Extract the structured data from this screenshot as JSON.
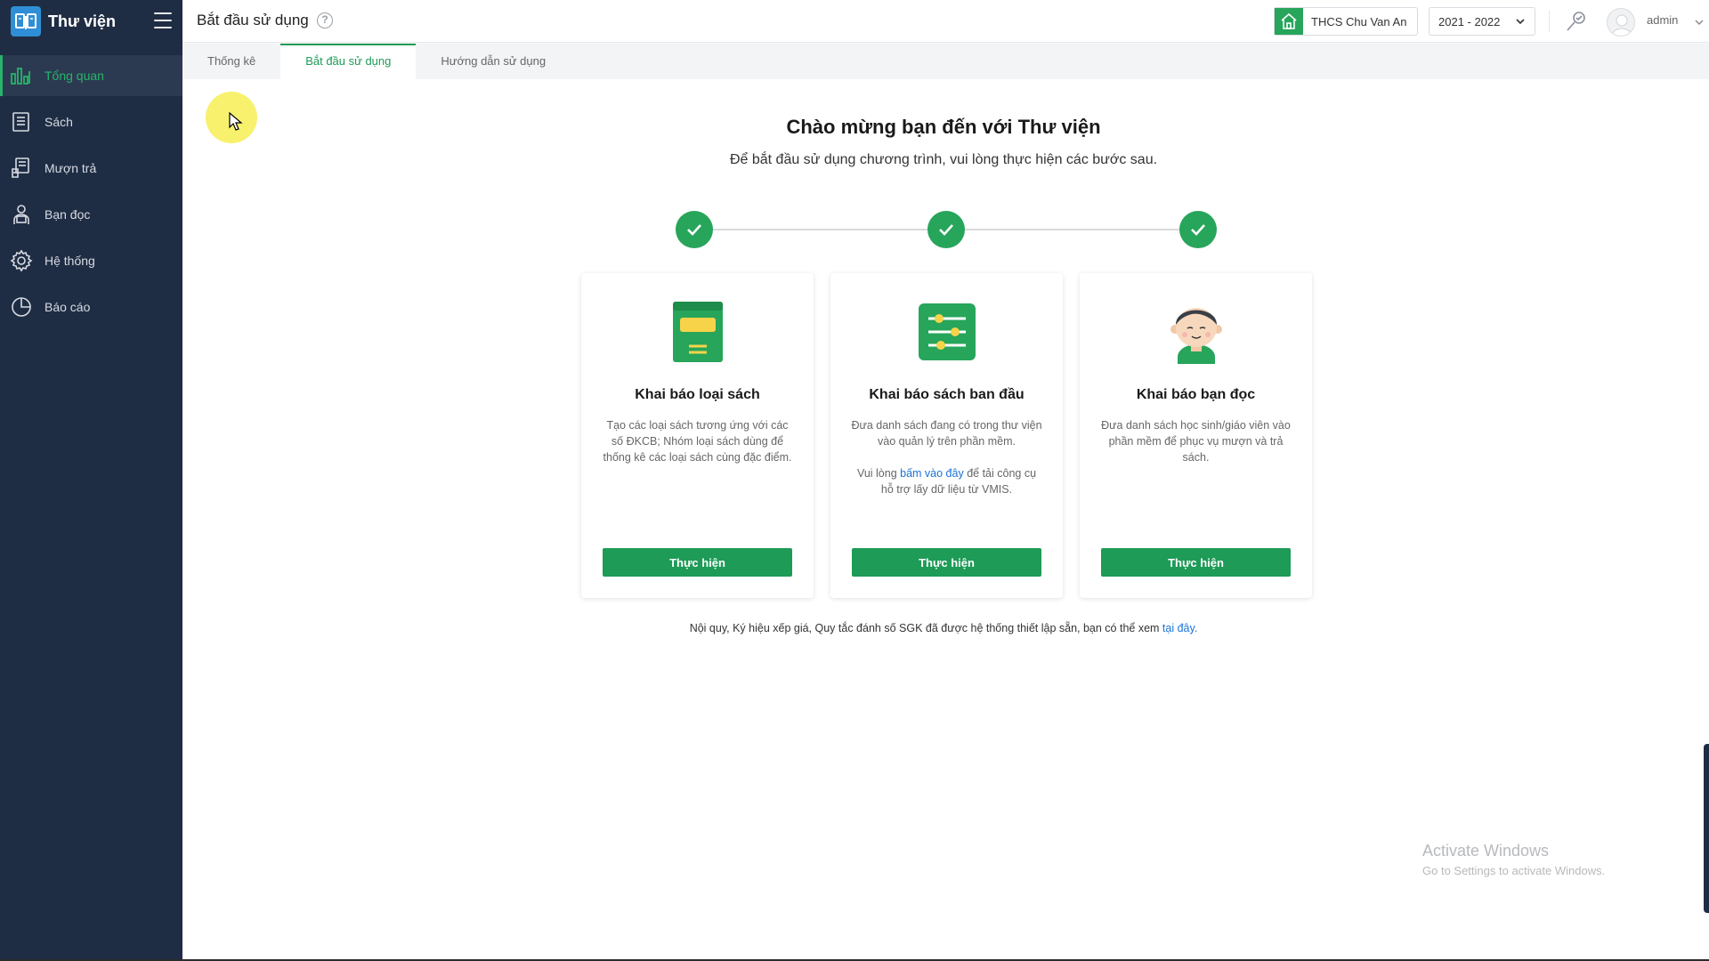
{
  "app": {
    "title": "Thư viện"
  },
  "sidebar": {
    "items": [
      {
        "label": "Tổng quan",
        "icon": "bar-chart-icon",
        "active": true
      },
      {
        "label": "Sách",
        "icon": "book-icon",
        "active": false
      },
      {
        "label": "Mượn trả",
        "icon": "borrow-return-icon",
        "active": false
      },
      {
        "label": "Bạn đọc",
        "icon": "reader-icon",
        "active": false
      },
      {
        "label": "Hệ thống",
        "icon": "gear-icon",
        "active": false
      },
      {
        "label": "Báo cáo",
        "icon": "pie-chart-icon",
        "active": false
      }
    ]
  },
  "header": {
    "page_title": "Bắt đầu sử dụng",
    "help_symbol": "?",
    "school": "THCS Chu Van An",
    "year": "2021 - 2022",
    "username": "admin"
  },
  "tabs": [
    {
      "label": "Thống kê",
      "active": false
    },
    {
      "label": "Bắt đầu sử dụng",
      "active": true
    },
    {
      "label": "Hướng dẫn sử dụng",
      "active": false
    }
  ],
  "main": {
    "title": "Chào mừng bạn đến với Thư viện",
    "subtitle": "Để bắt đầu sử dụng chương trình, vui lòng thực hiện các bước sau.",
    "steps_completed": 3,
    "cards": [
      {
        "title": "Khai báo loại sách",
        "description": "Tạo các loại sách tương ứng với các số ĐKCB; Nhóm loại sách dùng để thống kê các loại sách cùng đặc điểm.",
        "button": "Thực hiện"
      },
      {
        "title": "Khai báo sách ban đầu",
        "description": "Đưa danh sách đang có trong thư viện vào quản lý trên phần mềm.",
        "note_prefix": "Vui lòng ",
        "note_link": "bấm vào đây",
        "note_suffix": " để tải công cụ hỗ trợ lấy dữ liệu từ VMIS.",
        "button": "Thực hiện"
      },
      {
        "title": "Khai báo bạn đọc",
        "description": "Đưa danh sách học sinh/giáo viên vào phần mềm để phục vụ mượn và trả sách.",
        "button": "Thực hiện"
      }
    ],
    "footer_text": "Nội quy, Ký hiệu xếp giá, Quy tắc đánh số SGK đã được hệ thống thiết lập sẵn, bạn có thể xem ",
    "footer_link": "tại đây."
  },
  "watermark": {
    "line1": "Activate Windows",
    "line2": "Go to Settings to activate Windows."
  },
  "colors": {
    "sidebar_bg": "#1f2d44",
    "accent_green": "#1d9b57",
    "link_blue": "#1a73d9"
  }
}
